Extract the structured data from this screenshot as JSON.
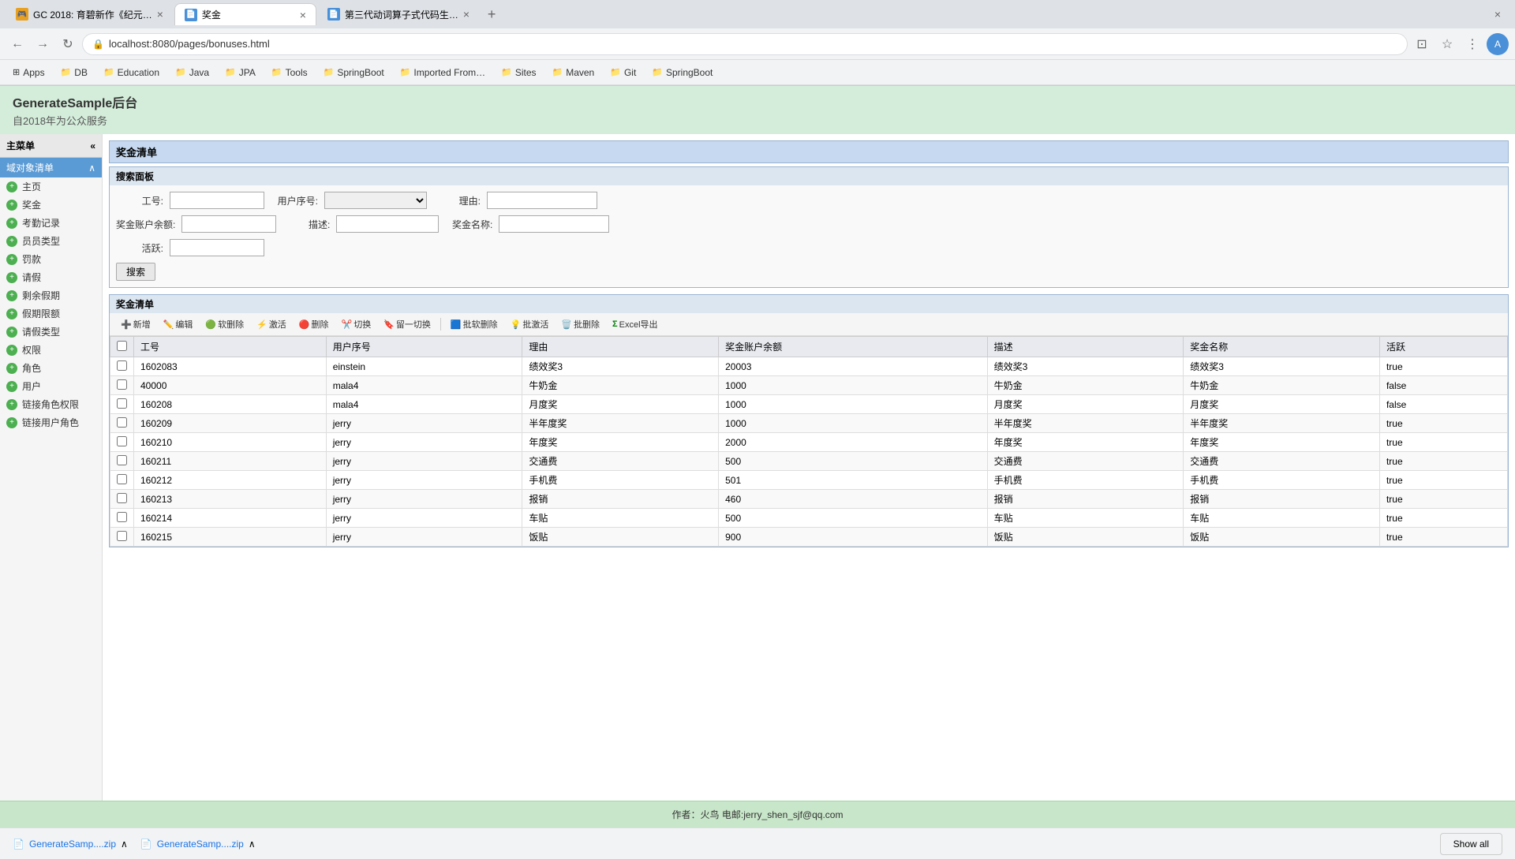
{
  "browser": {
    "tabs": [
      {
        "id": "tab1",
        "title": "GC 2018: 育碧新作《纪元…",
        "active": false,
        "favicon": "🎮"
      },
      {
        "id": "tab2",
        "title": "奖金",
        "active": true,
        "favicon": "📄"
      },
      {
        "id": "tab3",
        "title": "第三代动词算子式代码生…",
        "active": false,
        "favicon": "📄"
      }
    ],
    "address": "localhost:8080/pages/bonuses.html",
    "bookmarks": [
      {
        "label": "Apps",
        "icon": "⊞"
      },
      {
        "label": "DB",
        "icon": "📁"
      },
      {
        "label": "Education",
        "icon": "📁"
      },
      {
        "label": "Java",
        "icon": "📁"
      },
      {
        "label": "JPA",
        "icon": "📁"
      },
      {
        "label": "Tools",
        "icon": "📁"
      },
      {
        "label": "SpringBoot",
        "icon": "📁"
      },
      {
        "label": "Imported From…",
        "icon": "📁"
      },
      {
        "label": "Sites",
        "icon": "📁"
      },
      {
        "label": "Maven",
        "icon": "📁"
      },
      {
        "label": "Git",
        "icon": "📁"
      },
      {
        "label": "SpringBoot",
        "icon": "📁"
      }
    ]
  },
  "app": {
    "title": "GenerateSample后台",
    "subtitle": "自2018年为公众服务"
  },
  "sidebar": {
    "header": "主菜单",
    "section": "域对象清单",
    "items": [
      {
        "label": "主页"
      },
      {
        "label": "奖金"
      },
      {
        "label": "考勤记录"
      },
      {
        "label": "员员类型"
      },
      {
        "label": "罚款"
      },
      {
        "label": "请假"
      },
      {
        "label": "剩余假期"
      },
      {
        "label": "假期限额"
      },
      {
        "label": "请假类型"
      },
      {
        "label": "权限"
      },
      {
        "label": "角色"
      },
      {
        "label": "用户"
      },
      {
        "label": "链接角色权限"
      },
      {
        "label": "链接用户角色"
      }
    ]
  },
  "page": {
    "breadcrumb": "奖金清单",
    "search_panel": {
      "title": "搜索面板",
      "fields": [
        {
          "label": "工号:",
          "type": "input",
          "name": "worker_id"
        },
        {
          "label": "用户序号:",
          "type": "select",
          "name": "user_seq"
        },
        {
          "label": "理由:",
          "type": "input",
          "name": "reason"
        },
        {
          "label": "奖金账户余额:",
          "type": "input",
          "name": "balance"
        },
        {
          "label": "描述:",
          "type": "input",
          "name": "description"
        },
        {
          "label": "奖金名称:",
          "type": "input",
          "name": "bonus_name"
        },
        {
          "label": "活跃:",
          "type": "input",
          "name": "active"
        }
      ],
      "search_btn": "搜索"
    },
    "table": {
      "title": "奖金清单",
      "toolbar": [
        {
          "label": "新增",
          "icon": "➕",
          "color": "green"
        },
        {
          "label": "编辑",
          "icon": "✏️",
          "color": "blue"
        },
        {
          "label": "软删除",
          "icon": "🟢",
          "color": "green"
        },
        {
          "label": "激活",
          "icon": "⚡",
          "color": "yellow"
        },
        {
          "label": "删除",
          "icon": "🔴",
          "color": "red"
        },
        {
          "label": "切换",
          "icon": "✂️",
          "color": "orange"
        },
        {
          "label": "留一切换",
          "icon": "🔖",
          "color": "blue"
        },
        {
          "label": "批软删除",
          "icon": "🟦",
          "color": "blue"
        },
        {
          "label": "批激活",
          "icon": "💡",
          "color": "yellow"
        },
        {
          "label": "批删除",
          "icon": "🗑️",
          "color": "gray"
        },
        {
          "label": "Excel导出",
          "icon": "Σ",
          "color": "green"
        }
      ],
      "columns": [
        "工号",
        "用户序号",
        "理由",
        "奖金账户余额",
        "描述",
        "奖金名称",
        "活跃"
      ],
      "rows": [
        {
          "id": "1602083",
          "user_seq": "einstein",
          "reason": "绩效奖3",
          "balance": "20003",
          "desc": "绩效奖3",
          "name": "绩效奖3",
          "active": "true"
        },
        {
          "id": "40000",
          "user_seq": "mala4",
          "reason": "牛奶金",
          "balance": "1000",
          "desc": "牛奶金",
          "name": "牛奶金",
          "active": "false"
        },
        {
          "id": "160208",
          "user_seq": "mala4",
          "reason": "月度奖",
          "balance": "1000",
          "desc": "月度奖",
          "name": "月度奖",
          "active": "false"
        },
        {
          "id": "160209",
          "user_seq": "jerry",
          "reason": "半年度奖",
          "balance": "1000",
          "desc": "半年度奖",
          "name": "半年度奖",
          "active": "true"
        },
        {
          "id": "160210",
          "user_seq": "jerry",
          "reason": "年度奖",
          "balance": "2000",
          "desc": "年度奖",
          "name": "年度奖",
          "active": "true"
        },
        {
          "id": "160211",
          "user_seq": "jerry",
          "reason": "交通费",
          "balance": "500",
          "desc": "交通费",
          "name": "交通费",
          "active": "true"
        },
        {
          "id": "160212",
          "user_seq": "jerry",
          "reason": "手机费",
          "balance": "501",
          "desc": "手机费",
          "name": "手机费",
          "active": "true"
        },
        {
          "id": "160213",
          "user_seq": "jerry",
          "reason": "报销",
          "balance": "460",
          "desc": "报销",
          "name": "报销",
          "active": "true"
        },
        {
          "id": "160214",
          "user_seq": "jerry",
          "reason": "车贴",
          "balance": "500",
          "desc": "车贴",
          "name": "车贴",
          "active": "true"
        },
        {
          "id": "160215",
          "user_seq": "jerry",
          "reason": "饭贴",
          "balance": "900",
          "desc": "饭贴",
          "name": "饭贴",
          "active": "true"
        }
      ]
    }
  },
  "footer": {
    "text": "作者：火鸟 电邮:jerry_shen_sjf@qq.com"
  },
  "downloads": [
    {
      "name": "GenerateSamp....zip"
    },
    {
      "name": "GenerateSamp....zip"
    }
  ],
  "show_all": "Show all"
}
